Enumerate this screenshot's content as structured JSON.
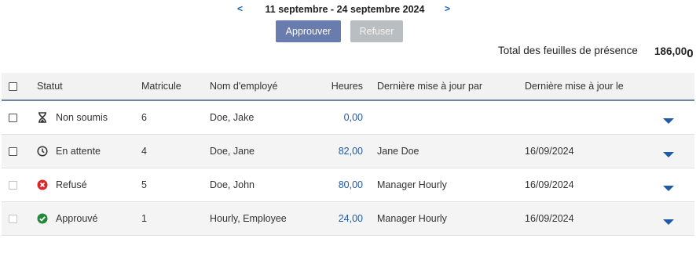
{
  "header": {
    "prev_label": "<",
    "next_label": ">",
    "period": "11 septembre - 24 septembre 2024",
    "approve_label": "Approuver",
    "reject_label": "Refuser",
    "total_label": "Total des feuilles de présence",
    "total_value": "186,00",
    "total_tail": "0"
  },
  "table": {
    "columns": {
      "status": "Statut",
      "matricule": "Matricule",
      "name": "Nom d'employé",
      "hours": "Heures",
      "updated_by": "Dernière mise à jour par",
      "updated_on": "Dernière mise à jour le"
    },
    "rows": [
      {
        "status": "Non soumis",
        "icon": "hourglass-icon",
        "matricule": "6",
        "name": "Doe, Jake",
        "hours": "0,00",
        "updated_by": "",
        "updated_on": "",
        "selectable": true
      },
      {
        "status": "En attente",
        "icon": "clock-icon",
        "matricule": "4",
        "name": "Doe, Jane",
        "hours": "82,00",
        "updated_by": "Jane Doe",
        "updated_on": "16/09/2024",
        "selectable": true
      },
      {
        "status": "Refusé",
        "icon": "rejected-x-icon",
        "matricule": "5",
        "name": "Doe, John",
        "hours": "80,00",
        "updated_by": "Manager Hourly",
        "updated_on": "16/09/2024",
        "selectable": false
      },
      {
        "status": "Approuvé",
        "icon": "approved-check-icon",
        "matricule": "1",
        "name": "Hourly, Employee",
        "hours": "24,00",
        "updated_by": "Manager Hourly",
        "updated_on": "16/09/2024",
        "selectable": false
      }
    ]
  },
  "colors": {
    "accent": "#1f5aa6",
    "approve_button": "#6a7cad",
    "reject_button": "#b9bec3",
    "rejected": "#d9262a",
    "approved": "#23883a"
  }
}
